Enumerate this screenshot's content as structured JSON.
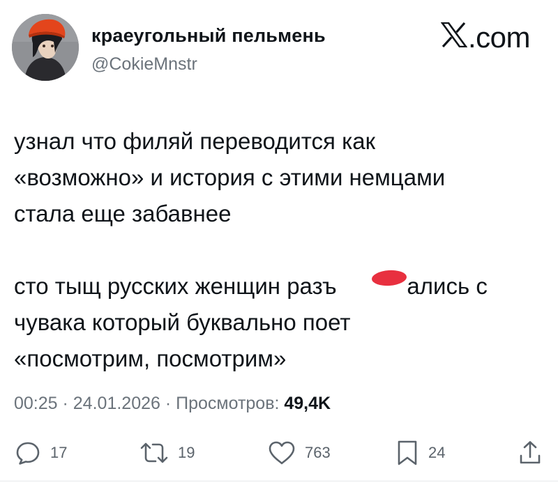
{
  "author": {
    "display_name": "краеугольный пельмень",
    "handle": "@CokieMnstr"
  },
  "brand": {
    "label": ".com",
    "icon": "x-logo-icon"
  },
  "post": {
    "paragraphs": [
      [
        "узнал что филяй переводится как",
        "«возможно» и история с этими немцами",
        "стала еще забавнее"
      ],
      [
        "сто тыщ русских женщин разъ           ались с",
        "чувака который буквально поет",
        "«посмотрим, посмотрим»"
      ]
    ],
    "censor_color": "#e8303f"
  },
  "meta": {
    "time": "00:25",
    "separator": " · ",
    "date": "24.01.2026",
    "views_label": "Просмотров: ",
    "views_count": "49,4K"
  },
  "actions": {
    "reply": {
      "icon": "reply-icon",
      "count": "17"
    },
    "retweet": {
      "icon": "retweet-icon",
      "count": "19"
    },
    "like": {
      "icon": "heart-icon",
      "count": "763"
    },
    "bookmark": {
      "icon": "bookmark-icon",
      "count": "24"
    },
    "share": {
      "icon": "share-icon"
    }
  },
  "colors": {
    "text": "#0f1419",
    "secondary": "#6b737b",
    "icon": "#5b636b"
  }
}
